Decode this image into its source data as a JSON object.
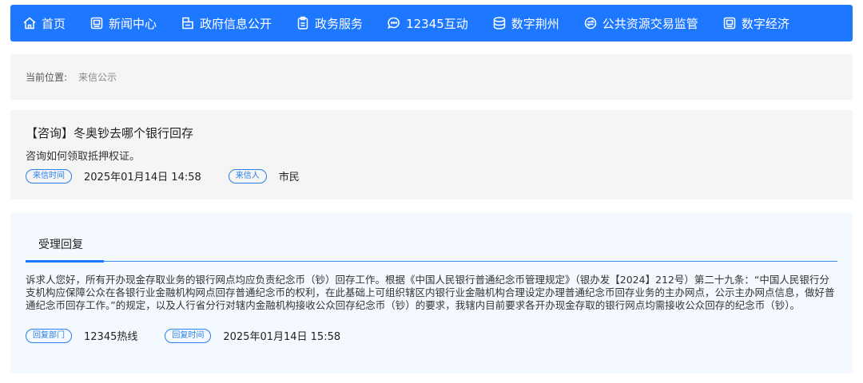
{
  "nav": {
    "items": [
      {
        "label": "首页",
        "icon": "home-icon"
      },
      {
        "label": "新闻中心",
        "icon": "news-icon"
      },
      {
        "label": "政府信息公开",
        "icon": "info-icon"
      },
      {
        "label": "政务服务",
        "icon": "clipboard-icon"
      },
      {
        "label": "12345互动",
        "icon": "chat-icon"
      },
      {
        "label": "数字荆州",
        "icon": "database-icon"
      },
      {
        "label": "公共资源交易监管",
        "icon": "exchange-icon"
      },
      {
        "label": "数字经济",
        "icon": "economy-icon"
      }
    ]
  },
  "breadcrumb": {
    "label": "当前位置:",
    "current": "来信公示"
  },
  "letter": {
    "title": "【咨询】冬奥钞去哪个银行回存",
    "content": "咨询如何领取抵押权证。",
    "time_tag": "来信时间",
    "time": "2025年01月14日 14:58",
    "sender_tag": "来信人",
    "sender": "市民"
  },
  "reply": {
    "tab": "受理回复",
    "body": "诉求人您好，所有开办现金存取业务的银行网点均应负责纪念币（钞）回存工作。根据《中国人民银行普通纪念币管理规定》（银办发【2024】212号）第二十九条：“中国人民银行分支机构应保障公众在各银行业金融机构网点回存普通纪念币的权利，在此基础上可组织辖区内银行业金融机构合理设定办理普通纪念币回存业务的主办网点，公示主办网点信息，做好普通纪念币回存工作。”的规定，以及人行省分行对辖内金融机构接收公众回存纪念币（钞）的要求，我辖内目前要求各开办现金存取的银行网点均需接收公众回存的纪念币（钞）。",
    "dept_tag": "回复部门",
    "dept": "12345热线",
    "time_tag": "回复时间",
    "time": "2025年01月14日 15:58"
  }
}
